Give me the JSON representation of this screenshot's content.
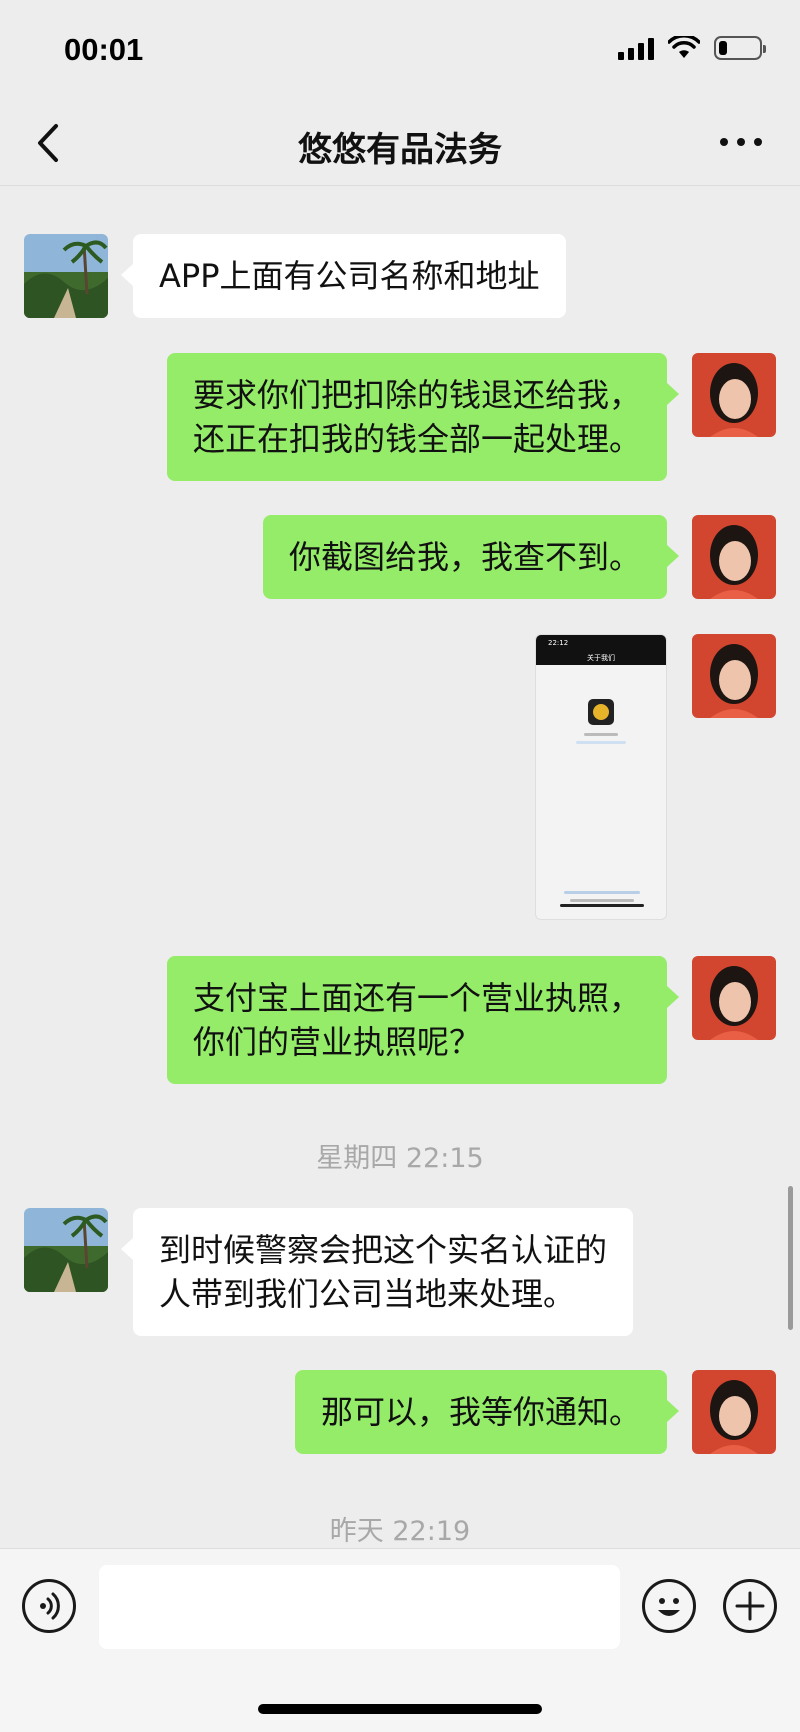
{
  "status_bar": {
    "time": "00:01",
    "battery_level": 0.22
  },
  "nav": {
    "title": "悠悠有品法务"
  },
  "messages": [
    {
      "side": "in",
      "type": "text",
      "text": "APP上面有公司名称和地址",
      "avatar": "palm-garden-avatar"
    },
    {
      "side": "out",
      "type": "text",
      "lines": [
        "要求你们把扣除的钱退还给我，",
        "还正在扣我的钱全部一起处理。"
      ],
      "avatar": "woman-avatar"
    },
    {
      "side": "out",
      "type": "text",
      "text": "你截图给我，我查不到。",
      "avatar": "woman-avatar"
    },
    {
      "side": "out",
      "type": "image",
      "avatar": "woman-avatar"
    },
    {
      "side": "out",
      "type": "text",
      "lines": [
        "支付宝上面还有一个营业执照，",
        "你们的营业执照呢？"
      ],
      "avatar": "woman-avatar"
    },
    {
      "type": "timestamp",
      "text": "星期四 22:15"
    },
    {
      "side": "in",
      "type": "text",
      "lines": [
        "到时候警察会把这个实名认证的",
        "人带到我们公司当地来处理。"
      ],
      "avatar": "palm-garden-avatar"
    },
    {
      "side": "out",
      "type": "text",
      "text": "那可以，我等你通知。",
      "avatar": "woman-avatar"
    },
    {
      "type": "timestamp",
      "text": "昨天 22:19"
    }
  ],
  "screenshot_thumb": {
    "time": "22:12",
    "header": "关于我们"
  },
  "input": {
    "value": ""
  },
  "colors": {
    "outgoing_bubble": "#95ec69",
    "incoming_bubble": "#ffffff",
    "background": "#ededed"
  }
}
